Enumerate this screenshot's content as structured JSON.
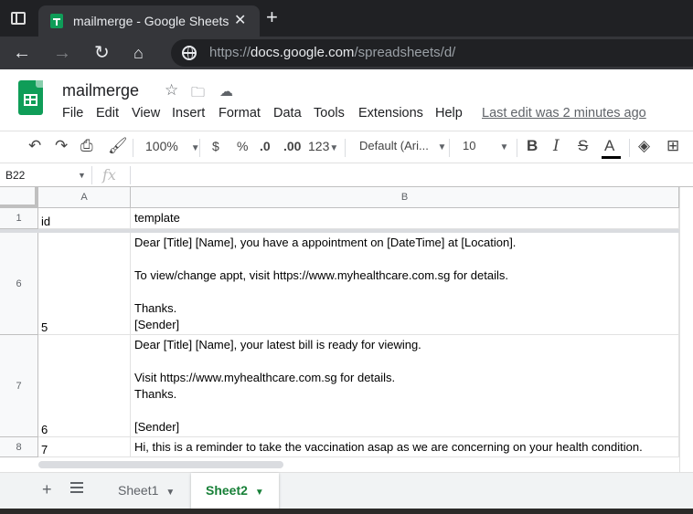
{
  "browser": {
    "tab_title": "mailmerge - Google Sheets",
    "url_prefix": "https://",
    "url_host": "docs.google.com",
    "url_path": "/spreadsheets/d/"
  },
  "doc": {
    "title": "mailmerge",
    "menu": [
      "File",
      "Edit",
      "View",
      "Insert",
      "Format",
      "Data",
      "Tools",
      "Extensions",
      "Help"
    ],
    "last_edit": "Last edit was 2 minutes ago"
  },
  "toolbar": {
    "zoom": "100%",
    "currency": "$",
    "percent": "%",
    "dec_decrease": ".0",
    "dec_increase": ".00",
    "more_formats": "123",
    "font": "Default (Ari...",
    "font_size": "10",
    "bold": "B",
    "italic": "I",
    "strike": "S",
    "text_color": "A"
  },
  "formula_bar": {
    "name_box": "B22",
    "fx": "fx"
  },
  "grid": {
    "columns": [
      "A",
      "B"
    ],
    "rows": [
      {
        "num": "1",
        "a": "id",
        "b": "template"
      },
      {
        "num": "6",
        "a": "5",
        "b": "Dear [Title] [Name], you have a appointment on [DateTime] at [Location].\n\nTo view/change appt, visit https://www.myhealthcare.com.sg for details.\n\nThanks.\n[Sender]"
      },
      {
        "num": "7",
        "a": "6",
        "b": "Dear [Title] [Name], your latest bill is ready for viewing.\n\nVisit https://www.myhealthcare.com.sg for details.\nThanks.\n\n[Sender]"
      },
      {
        "num": "8",
        "a": "7",
        "b": "Hi, this is a reminder to take the vaccination asap as we are concerning on your health condition."
      }
    ]
  },
  "sheets": {
    "tabs": [
      "Sheet1",
      "Sheet2"
    ],
    "active": "Sheet2",
    "active_color": "#188038"
  },
  "colors": {
    "chrome_dark": "#202124",
    "sheets_green": "#0f9d58"
  }
}
